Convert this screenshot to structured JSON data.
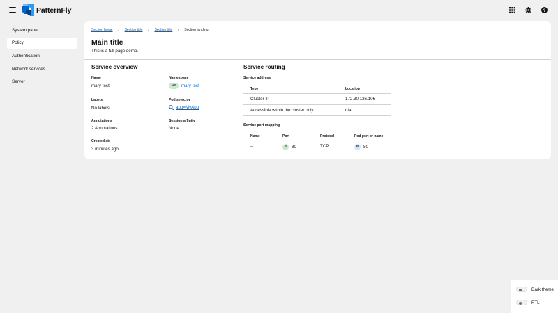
{
  "masthead": {
    "brand": "PatternFly",
    "menu_icon": "hamburger-icon",
    "tools": [
      "grid-icon",
      "gear-icon",
      "help-icon"
    ]
  },
  "sidebar": {
    "items": [
      {
        "label": "System panel",
        "active": false
      },
      {
        "label": "Policy",
        "active": true
      },
      {
        "label": "Authentication",
        "active": false
      },
      {
        "label": "Network services",
        "active": false
      },
      {
        "label": "Server",
        "active": false
      }
    ]
  },
  "breadcrumb": {
    "items": [
      "Section home",
      "Section title",
      "Section title",
      "Section landing"
    ]
  },
  "page": {
    "title": "Main title",
    "subtitle": "This is a full page demo."
  },
  "overview": {
    "title": "Service overview",
    "name_label": "Name",
    "name_value": "mary-test",
    "namespace_label": "Namespace",
    "namespace_badge": "NS",
    "namespace_value": "mary-test",
    "labels_label": "Labels",
    "labels_value": "No labels",
    "pod_selector_label": "Pod selector",
    "pod_selector_value": "app=MyApp",
    "annotations_label": "Annotations",
    "annotations_value": "2 Annotations",
    "session_affinity_label": "Session affinity",
    "session_affinity_value": "None",
    "created_label": "Created at:",
    "created_value": "3 minutes ago"
  },
  "routing": {
    "title": "Service routing",
    "address_label": "Service address",
    "address_table": {
      "headers": [
        "Type",
        "Location"
      ],
      "rows": [
        [
          "Cluster IP",
          "172.30.126.106"
        ],
        [
          "Accessible within the cluster only",
          "n/a"
        ]
      ]
    },
    "port_mapping_label": "Service port mapping",
    "port_table": {
      "headers": [
        "Name",
        "Port",
        "Protocol",
        "Pod port or name"
      ],
      "row": {
        "name": "--",
        "port_badge": "S",
        "port": "80",
        "protocol": "TCP",
        "pod_port_badge": "P",
        "pod_port": "80"
      }
    }
  },
  "theme_switches": {
    "dark_theme": "Dark theme",
    "rtl": "RTL"
  }
}
